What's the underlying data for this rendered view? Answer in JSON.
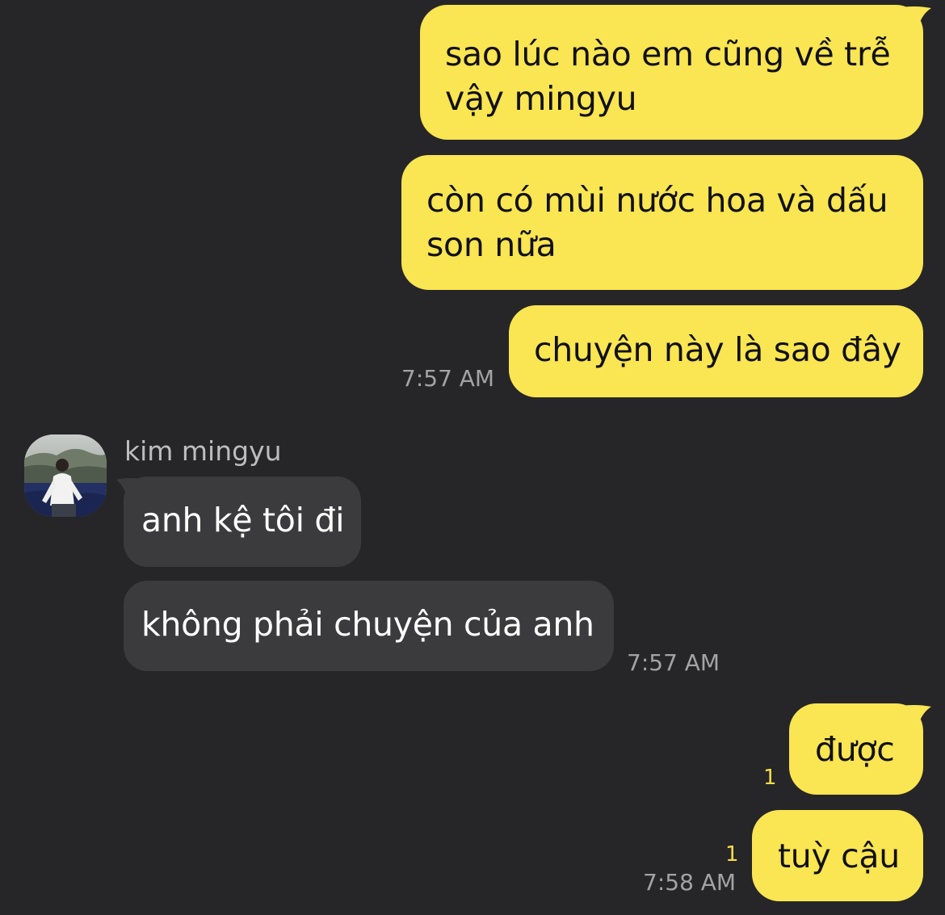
{
  "messages": {
    "m1": {
      "line1": "sao lúc nào em cũng về trễ",
      "line2": "vậy mingyu"
    },
    "m2": {
      "line1": "còn có mùi nước hoa và dấu",
      "line2": "son nữa"
    },
    "m3": {
      "text": "chuyện này là sao đây",
      "time": "7:57 AM"
    },
    "contact": {
      "name": "kim mingyu"
    },
    "m4": {
      "text": "anh kệ tôi đi"
    },
    "m5": {
      "text": "không phải chuyện của anh",
      "time": "7:57 AM"
    },
    "m6": {
      "text": "được",
      "unread": "1"
    },
    "m7": {
      "text": "tuỳ cậu",
      "unread": "1",
      "time": "7:58 AM"
    }
  },
  "colors": {
    "background": "#262628",
    "outgoing_bubble": "#fae552",
    "incoming_bubble": "#3b3b3d",
    "timestamp": "#a3a3a6",
    "unread_count": "#f3dd4c"
  },
  "icons": {
    "avatar": "profile-photo"
  }
}
